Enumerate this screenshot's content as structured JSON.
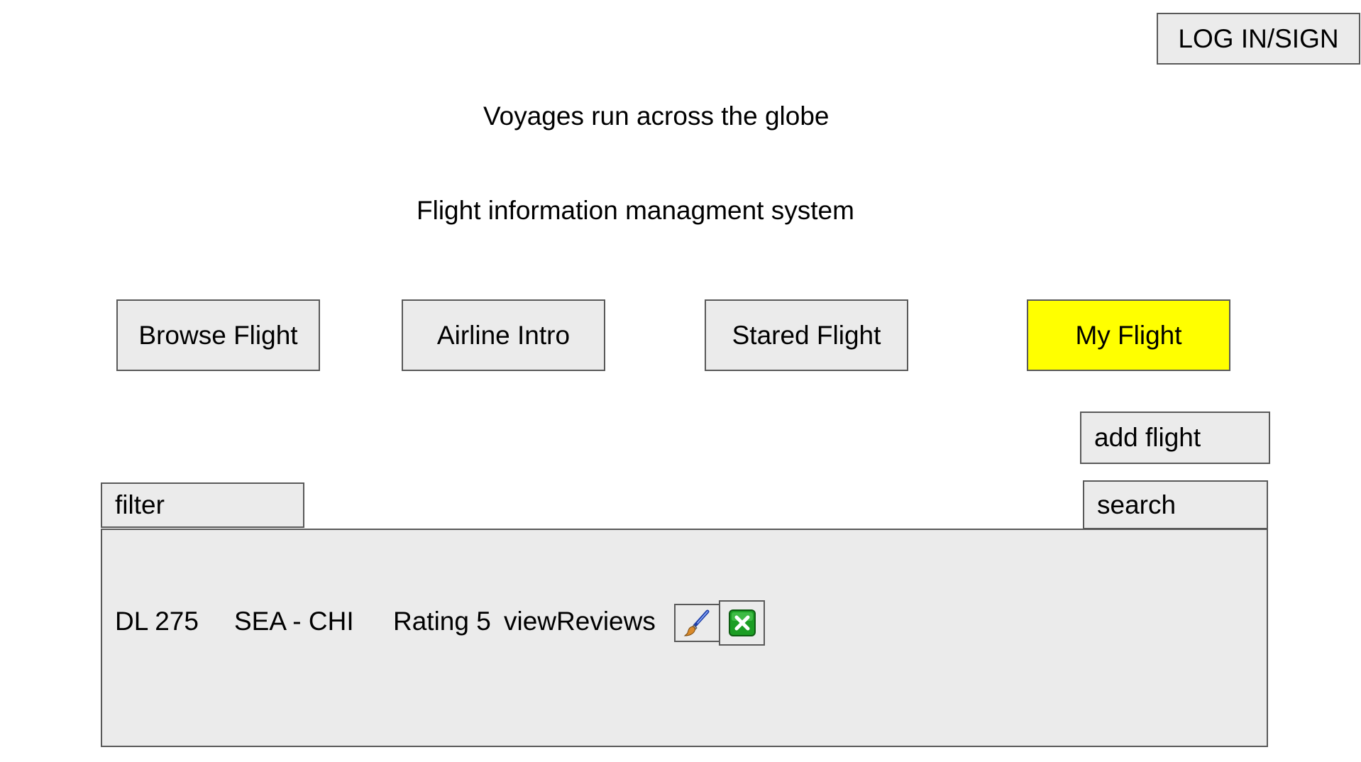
{
  "header": {
    "login_label": "LOG IN/SIGN",
    "title": "Voyages run across the globe",
    "subtitle": "Flight information managment system"
  },
  "nav": {
    "items": [
      {
        "label": "Browse Flight"
      },
      {
        "label": "Airline Intro"
      },
      {
        "label": "Stared Flight"
      },
      {
        "label": "My Flight",
        "active": true
      }
    ],
    "active_color": "#ffff00"
  },
  "toolbar": {
    "add_label": "add flight",
    "filter_label": "filter",
    "search_label": "search"
  },
  "flights": [
    {
      "code": "DL 275",
      "route": "SEA - CHI",
      "rating": "Rating 5",
      "reviews_link": "viewReviews",
      "edit_icon": "paintbrush-icon",
      "delete_icon": "close-icon"
    }
  ]
}
